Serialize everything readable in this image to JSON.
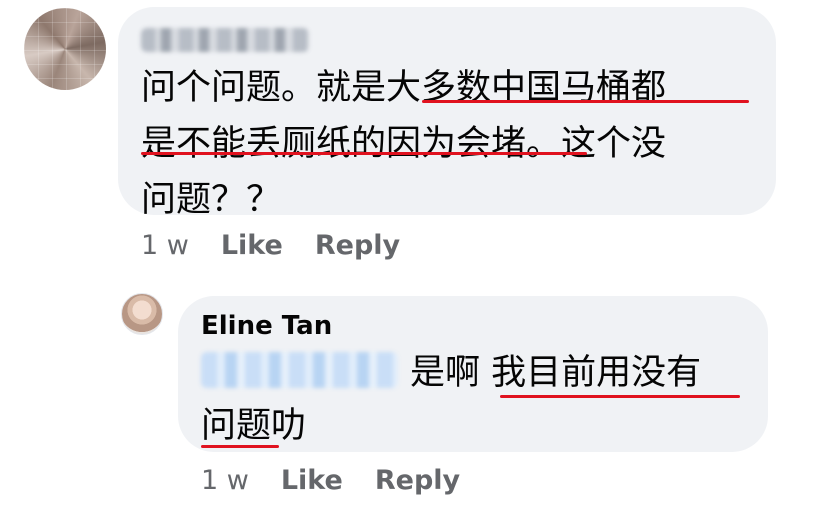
{
  "comments": [
    {
      "avatar": "blurred-profile-picture",
      "text_line1": "问个问题。就是大多数中国马桶都",
      "text_line2": "是不能丢厕纸的因为会堵。这个没",
      "text_line3": "问题？？",
      "time": "1 w",
      "like_label": "Like",
      "reply_label": "Reply"
    }
  ],
  "reply": {
    "author": "Eline Tan",
    "text_line1": "是啊 我目前用没有",
    "text_line2": "问题叻",
    "time": "1 w",
    "like_label": "Like",
    "reply_label": "Reply"
  },
  "colors": {
    "bubble": "#f0f2f5",
    "meta_text": "#65676b",
    "underline": "#e0121f"
  }
}
